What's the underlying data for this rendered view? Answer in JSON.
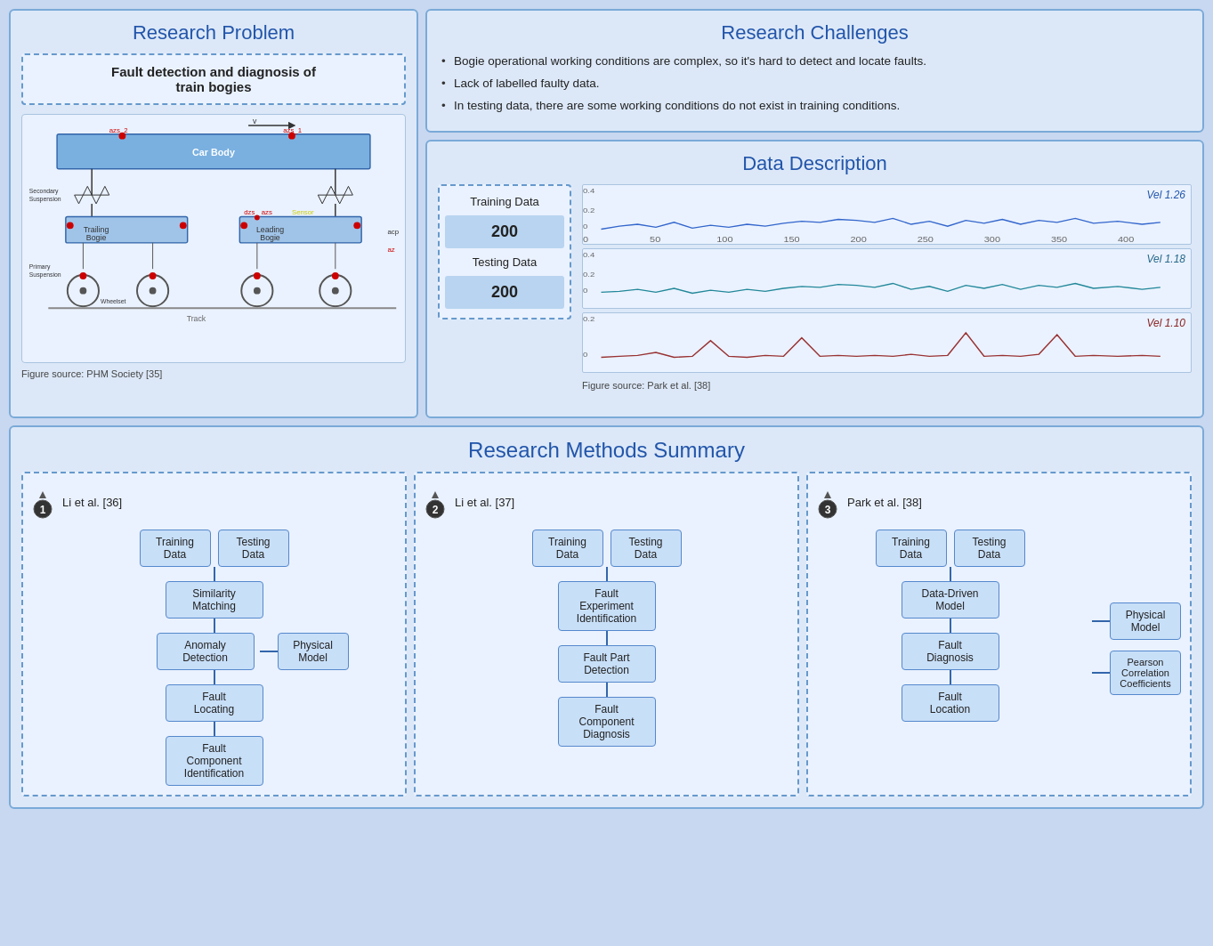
{
  "researchProblem": {
    "title": "Research Problem",
    "faultBox": "Fault detection and diagnosis of\ntrain bogies",
    "figureSource": "Figure source: PHM Society [35]"
  },
  "researchChallenges": {
    "title": "Research Challenges",
    "items": [
      "Bogie operational working conditions are complex, so it's hard to detect and locate faults.",
      "Lack of labelled faulty data.",
      "In testing data, there are some working conditions do not exist in training conditions."
    ]
  },
  "dataDescription": {
    "title": "Data Description",
    "trainingLabel": "Training Data",
    "trainingValue": "200",
    "testingLabel": "Testing Data",
    "testingValue": "200",
    "figureSource": "Figure source: Park et al. [38]",
    "chartLabels": [
      "Vel 1.26",
      "Vel 1.18",
      "Vel 1.10"
    ]
  },
  "researchMethods": {
    "title": "Research Methods Summary",
    "methods": [
      {
        "id": "1",
        "author": "Li et al. [36]",
        "steps": [
          [
            "Training\nData",
            "Testing\nData"
          ],
          [
            "Similarity\nMatching"
          ],
          [
            "Anomaly\nDetection"
          ],
          [
            "Fault\nLocating"
          ],
          [
            "Fault\nComponent\nIdentification"
          ]
        ],
        "sideBox": "Physical\nModel"
      },
      {
        "id": "2",
        "author": "Li et al. [37]",
        "steps": [
          [
            "Training\nData",
            "Testing\nData"
          ],
          [
            "Fault\nExperiment\nIdentification"
          ],
          [
            "Fault Part\nDetection"
          ],
          [
            "Fault\nComponent\nDiagnosis"
          ]
        ]
      },
      {
        "id": "3",
        "author": "Park et al. [38]",
        "mainSteps": [
          [
            "Training\nData",
            "Testing\nData"
          ],
          [
            "Data-Driven\nModel"
          ],
          [
            "Fault\nDiagnosis"
          ],
          [
            "Fault\nLocation"
          ]
        ],
        "sideBoxes": [
          "Physical\nModel",
          "Pearson\nCorrelation\nCoefficients"
        ]
      }
    ]
  }
}
